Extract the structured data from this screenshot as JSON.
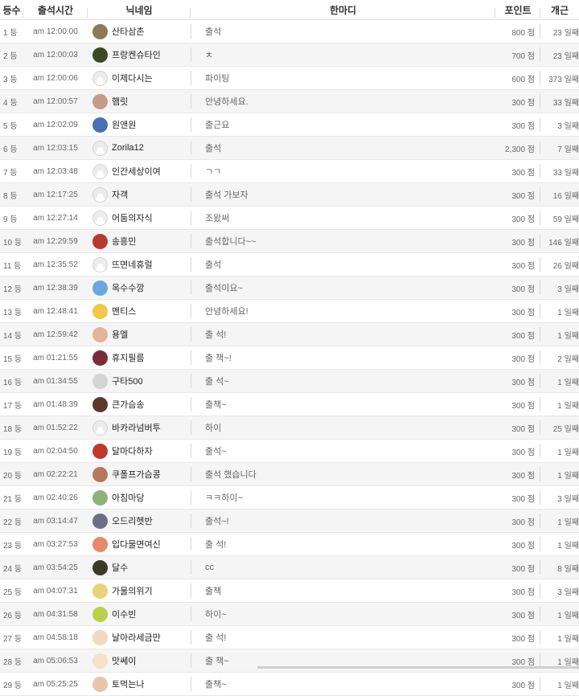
{
  "headers": {
    "rank": "등수",
    "time": "출석시간",
    "nick": "닉네임",
    "msg": "한마디",
    "point": "포인트",
    "count": "개근"
  },
  "rows": [
    {
      "rank": "1 등",
      "time": "am 12:00:00",
      "nick": "산타삼촌",
      "msg": "출석",
      "point": "800 점",
      "count": "23 일째",
      "avatar": "#8a7a55"
    },
    {
      "rank": "2 등",
      "time": "am 12:00:03",
      "nick": "프랑켄슈타인",
      "msg": "ㅊ",
      "point": "700 점",
      "count": "23 일째",
      "avatar": "#3b4a22"
    },
    {
      "rank": "3 등",
      "time": "am 12:00:06",
      "nick": "이제다시는",
      "msg": "파이팅",
      "point": "600 점",
      "count": "373 일째",
      "avatar": "default"
    },
    {
      "rank": "4 등",
      "time": "am 12:00:57",
      "nick": "햄릿",
      "msg": "안녕하세요.",
      "point": "300 점",
      "count": "33 일째",
      "avatar": "#c79a8a"
    },
    {
      "rank": "5 등",
      "time": "am 12:02:09",
      "nick": "원앤원",
      "msg": "출근요",
      "point": "300 점",
      "count": "3 일째",
      "avatar": "#4a6fb3"
    },
    {
      "rank": "6 등",
      "time": "am 12:03:15",
      "nick": "Zorila12",
      "msg": "출석",
      "point": "2,300 점",
      "count": "7 일째",
      "avatar": "default"
    },
    {
      "rank": "7 등",
      "time": "am 12:03:48",
      "nick": "인간세상이여",
      "msg": "ㄱㄱ",
      "point": "300 점",
      "count": "33 일째",
      "avatar": "default"
    },
    {
      "rank": "8 등",
      "time": "am 12:17:25",
      "nick": "자객",
      "msg": "출석 가보자",
      "point": "300 점",
      "count": "16 일째",
      "avatar": "default"
    },
    {
      "rank": "9 등",
      "time": "am 12:27:14",
      "nick": "어둠의자식",
      "msg": "조왔써",
      "point": "300 점",
      "count": "59 일째",
      "avatar": "default"
    },
    {
      "rank": "10 등",
      "time": "am 12:29:59",
      "nick": "송흥민",
      "msg": "출석합니다~~",
      "point": "300 점",
      "count": "146 일째",
      "avatar": "#b83a2e"
    },
    {
      "rank": "11 등",
      "time": "am 12:35:52",
      "nick": "뜨면네휴럴",
      "msg": "출석",
      "point": "300 점",
      "count": "26 일째",
      "avatar": "default"
    },
    {
      "rank": "12 등",
      "time": "am 12:38:39",
      "nick": "옥수수깡",
      "msg": "출석이요~",
      "point": "300 점",
      "count": "3 일째",
      "avatar": "#6aa7e0"
    },
    {
      "rank": "13 등",
      "time": "am 12:48:41",
      "nick": "멘티스",
      "msg": "안녕하세요!",
      "point": "300 점",
      "count": "1 일째",
      "avatar": "#f2c84b"
    },
    {
      "rank": "14 등",
      "time": "am 12:59:42",
      "nick": "용엘",
      "msg": "출 석!",
      "point": "300 점",
      "count": "1 일째",
      "avatar": "#e3b49a"
    },
    {
      "rank": "15 등",
      "time": "am 01:21:55",
      "nick": "휴지필름",
      "msg": "출 책~!",
      "point": "300 점",
      "count": "2 일째",
      "avatar": "#7a2b3a"
    },
    {
      "rank": "16 등",
      "time": "am 01:34:55",
      "nick": "구타500",
      "msg": "출 석~",
      "point": "300 점",
      "count": "1 일째",
      "avatar": "#d4d4d4"
    },
    {
      "rank": "17 등",
      "time": "am 01:48:39",
      "nick": "큰가슴송",
      "msg": "출책~",
      "point": "300 점",
      "count": "1 일째",
      "avatar": "#5a3a2e"
    },
    {
      "rank": "18 등",
      "time": "am 01:52:22",
      "nick": "바카라넘버투",
      "msg": "하이",
      "point": "300 점",
      "count": "25 일째",
      "avatar": "default"
    },
    {
      "rank": "19 등",
      "time": "am 02:04:50",
      "nick": "달마다하자",
      "msg": "출석~",
      "point": "300 점",
      "count": "1 일째",
      "avatar": "#c0392b"
    },
    {
      "rank": "20 등",
      "time": "am 02:22:21",
      "nick": "쿠폴프가슴콩",
      "msg": "출석 했습니다",
      "point": "300 점",
      "count": "1 일째",
      "avatar": "#b5785a"
    },
    {
      "rank": "21 등",
      "time": "am 02:40:26",
      "nick": "아침마당",
      "msg": "ㅋㅋ하이~",
      "point": "300 점",
      "count": "3 일째",
      "avatar": "#8fb07a"
    },
    {
      "rank": "22 등",
      "time": "am 03:14:47",
      "nick": "오드리헷반",
      "msg": "출석~!",
      "point": "300 점",
      "count": "1 일째",
      "avatar": "#6b6f8a"
    },
    {
      "rank": "23 등",
      "time": "am 03:27:53",
      "nick": "입다물면여신",
      "msg": "출 석!",
      "point": "300 점",
      "count": "1 일째",
      "avatar": "#e58a6a"
    },
    {
      "rank": "24 등",
      "time": "am 03:54:25",
      "nick": "달수",
      "msg": "cc",
      "point": "300 점",
      "count": "8 일째",
      "avatar": "#3a3a2a"
    },
    {
      "rank": "25 등",
      "time": "am 04:07:31",
      "nick": "가물의위기",
      "msg": "출책",
      "point": "300 점",
      "count": "3 일째",
      "avatar": "#e8d27a"
    },
    {
      "rank": "26 등",
      "time": "am 04:31:58",
      "nick": "이수빈",
      "msg": "하이~",
      "point": "300 점",
      "count": "1 일째",
      "avatar": "#b9d14a"
    },
    {
      "rank": "27 등",
      "time": "am 04:58:18",
      "nick": "날아라세금만",
      "msg": "출 석!",
      "point": "300 점",
      "count": "1 일째",
      "avatar": "#f0d9c0"
    },
    {
      "rank": "28 등",
      "time": "am 05:06:53",
      "nick": "맛쎄이",
      "msg": "출 책~",
      "point": "300 점",
      "count": "1 일째",
      "avatar": "#f3e2c8"
    },
    {
      "rank": "29 등",
      "time": "am 05:25:25",
      "nick": "토먹는나",
      "msg": "출책~",
      "point": "300 점",
      "count": "1 일째",
      "avatar": "#e8c4a8"
    }
  ]
}
